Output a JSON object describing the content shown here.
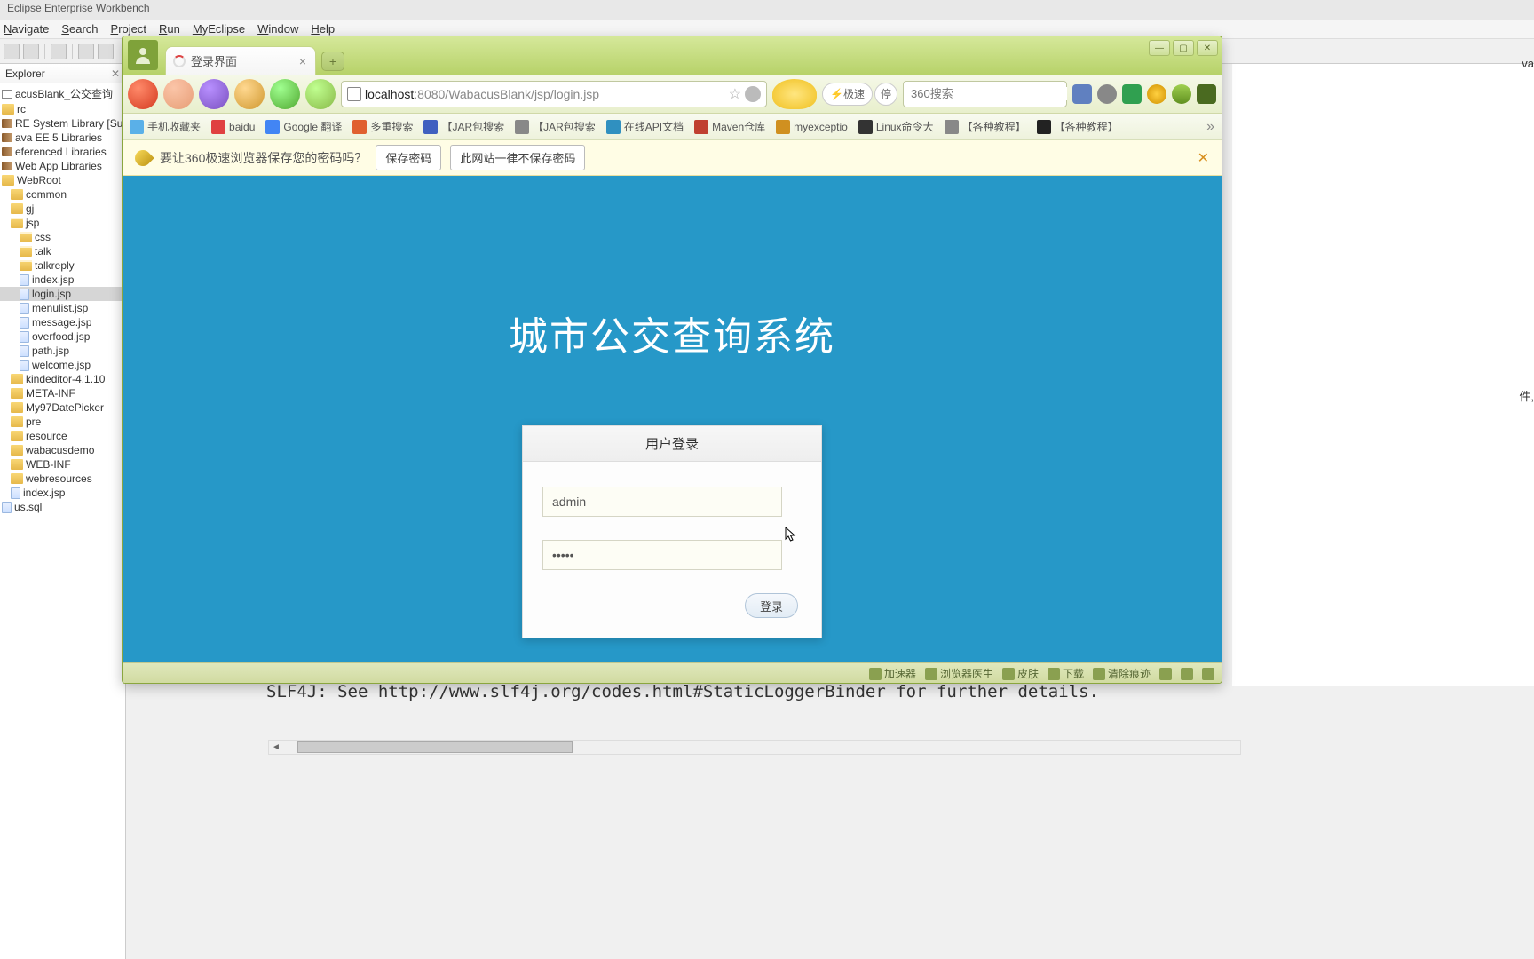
{
  "eclipse": {
    "title": "Eclipse Enterprise Workbench",
    "menu": [
      "Navigate",
      "Search",
      "Project",
      "Run",
      "MyEclipse",
      "Window",
      "Help"
    ]
  },
  "explorer": {
    "title": "Explorer",
    "items": [
      {
        "label": "acusBlank_公交查询",
        "icon": "prj",
        "indent": 0
      },
      {
        "label": "rc",
        "icon": "fld",
        "indent": 0
      },
      {
        "label": "RE System Library  [Sun JD",
        "icon": "lib",
        "indent": 0
      },
      {
        "label": "ava EE 5 Libraries",
        "icon": "lib",
        "indent": 0
      },
      {
        "label": "eferenced Libraries",
        "icon": "lib",
        "indent": 0
      },
      {
        "label": "Web App Libraries",
        "icon": "lib",
        "indent": 0
      },
      {
        "label": "WebRoot",
        "icon": "fld",
        "indent": 0
      },
      {
        "label": "common",
        "icon": "fld",
        "indent": 1
      },
      {
        "label": "gj",
        "icon": "fld",
        "indent": 1
      },
      {
        "label": "jsp",
        "icon": "fld-o",
        "indent": 1
      },
      {
        "label": "css",
        "icon": "fld-o",
        "indent": 2
      },
      {
        "label": "talk",
        "icon": "fld-o",
        "indent": 2
      },
      {
        "label": "talkreply",
        "icon": "fld-o",
        "indent": 2
      },
      {
        "label": "index.jsp",
        "icon": "jsp",
        "indent": 2
      },
      {
        "label": "login.jsp",
        "icon": "jsp",
        "indent": 2,
        "selected": true
      },
      {
        "label": "menulist.jsp",
        "icon": "jsp",
        "indent": 2
      },
      {
        "label": "message.jsp",
        "icon": "jsp",
        "indent": 2
      },
      {
        "label": "overfood.jsp",
        "icon": "jsp",
        "indent": 2
      },
      {
        "label": "path.jsp",
        "icon": "jsp",
        "indent": 2
      },
      {
        "label": "welcome.jsp",
        "icon": "jsp",
        "indent": 2
      },
      {
        "label": "kindeditor-4.1.10",
        "icon": "fld",
        "indent": 1
      },
      {
        "label": "META-INF",
        "icon": "fld",
        "indent": 1
      },
      {
        "label": "My97DatePicker",
        "icon": "fld",
        "indent": 1
      },
      {
        "label": "pre",
        "icon": "fld",
        "indent": 1
      },
      {
        "label": "resource",
        "icon": "fld",
        "indent": 1
      },
      {
        "label": "wabacusdemo",
        "icon": "fld",
        "indent": 1
      },
      {
        "label": "WEB-INF",
        "icon": "fld",
        "indent": 1
      },
      {
        "label": "webresources",
        "icon": "fld",
        "indent": 1
      },
      {
        "label": "index.jsp",
        "icon": "jsp",
        "indent": 1
      },
      {
        "label": "us.sql",
        "icon": "jsp",
        "indent": 0
      }
    ]
  },
  "browser": {
    "tab_title": "登录界面",
    "url_host": "localhost",
    "url_port_path": ":8080/WabacusBlank/jsp/login.jsp",
    "speed_label": "极速",
    "stop_label": "停",
    "search_placeholder": "360搜索",
    "bookmarks": [
      {
        "label": "手机收藏夹",
        "color": "#5ab0e8"
      },
      {
        "label": "baidu",
        "color": "#e04040"
      },
      {
        "label": "Google 翻译",
        "color": "#4285f4"
      },
      {
        "label": "多重搜索",
        "color": "#e06030"
      },
      {
        "label": "【JAR包搜索",
        "color": "#4060c0"
      },
      {
        "label": "【JAR包搜索",
        "color": "#888"
      },
      {
        "label": "在线API文档",
        "color": "#3090c0"
      },
      {
        "label": "Maven仓库",
        "color": "#c04030"
      },
      {
        "label": "myexceptio",
        "color": "#d09020"
      },
      {
        "label": "Linux命令大",
        "color": "#333"
      },
      {
        "label": "【各种教程】",
        "color": "#888"
      },
      {
        "label": "【各种教程】",
        "color": "#222"
      }
    ],
    "prompt": {
      "text": "要让360极速浏览器保存您的密码吗？",
      "save_btn": "保存密码",
      "never_btn": "此网站一律不保存密码"
    },
    "page": {
      "title": "城市公交查询系统",
      "login_head": "用户登录",
      "username_value": "admin",
      "password_value": "•••••",
      "login_btn": "登录"
    },
    "status": [
      {
        "label": "加速器"
      },
      {
        "label": "浏览器医生"
      },
      {
        "label": "皮肤"
      },
      {
        "label": "下载"
      },
      {
        "label": "清除痕迹"
      }
    ]
  },
  "console": {
    "line": "SLF4J: See http://www.slf4j.org/codes.html#StaticLoggerBinder for further details."
  },
  "right_fragments": {
    "va": "va",
    "jian": "件,"
  }
}
